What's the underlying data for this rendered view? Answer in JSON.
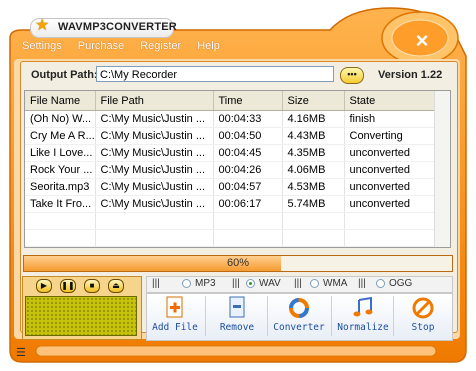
{
  "app": {
    "title": "WAVMP3CONVERTER"
  },
  "menu": [
    "Settings",
    "Purchase",
    "Register",
    "Help"
  ],
  "output": {
    "label": "Output Path:",
    "value": "C:\\My Recorder",
    "browse_label": "•••"
  },
  "version": "Version 1.22",
  "table": {
    "columns": [
      "File Name",
      "File Path",
      "Time",
      "Size",
      "State"
    ],
    "rows": [
      [
        "(Oh No) W...",
        "C:\\My Music\\Justin ...",
        "00:04:33",
        "4.16MB",
        "finish"
      ],
      [
        "Cry Me A R...",
        "C:\\My Music\\Justin ...",
        "00:04:50",
        "4.43MB",
        "Converting"
      ],
      [
        "Like I Love...",
        "C:\\My Music\\Justin ...",
        "00:04:45",
        "4.35MB",
        "unconverted"
      ],
      [
        "Rock Your ...",
        "C:\\My Music\\Justin ...",
        "00:04:26",
        "4.06MB",
        "unconverted"
      ],
      [
        "Seorita.mp3",
        "C:\\My Music\\Justin ...",
        "00:04:57",
        "4.53MB",
        "unconverted"
      ],
      [
        "Take It Fro...",
        "C:\\My Music\\Justin ...",
        "00:06:17",
        "5.74MB",
        "unconverted"
      ]
    ]
  },
  "progress": {
    "label": "60%",
    "value": 0.6
  },
  "formats": [
    {
      "label": "MP3",
      "selected": false
    },
    {
      "label": "WAV",
      "selected": true
    },
    {
      "label": "WMA",
      "selected": false
    },
    {
      "label": "OGG",
      "selected": false
    }
  ],
  "toolbar": {
    "add_file": "Add File",
    "remove": "Remove",
    "converter": "Converter",
    "normalize": "Normalize",
    "stop": "Stop"
  },
  "colors": {
    "accent": "#f7941d",
    "brand_orange": "#f58220",
    "panel": "#f2eee2",
    "lcd": "#c5c20a"
  }
}
